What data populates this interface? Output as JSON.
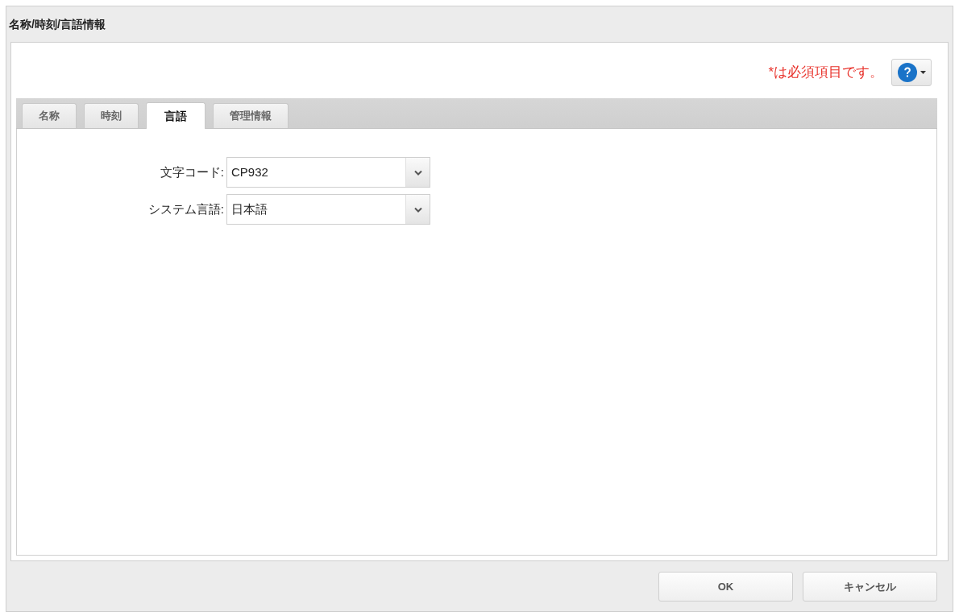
{
  "dialog": {
    "title": "名称/時刻/言語情報"
  },
  "required_note": "*は必須項目です。",
  "tabs": [
    {
      "label": "名称",
      "selected": false
    },
    {
      "label": "時刻",
      "selected": false
    },
    {
      "label": "言語",
      "selected": true
    },
    {
      "label": "管理情報",
      "selected": false
    }
  ],
  "fields": [
    {
      "label": "文字コード:",
      "value": "CP932"
    },
    {
      "label": "システム言語:",
      "value": "日本語"
    }
  ],
  "buttons": [
    "OK",
    "キャンセル"
  ]
}
